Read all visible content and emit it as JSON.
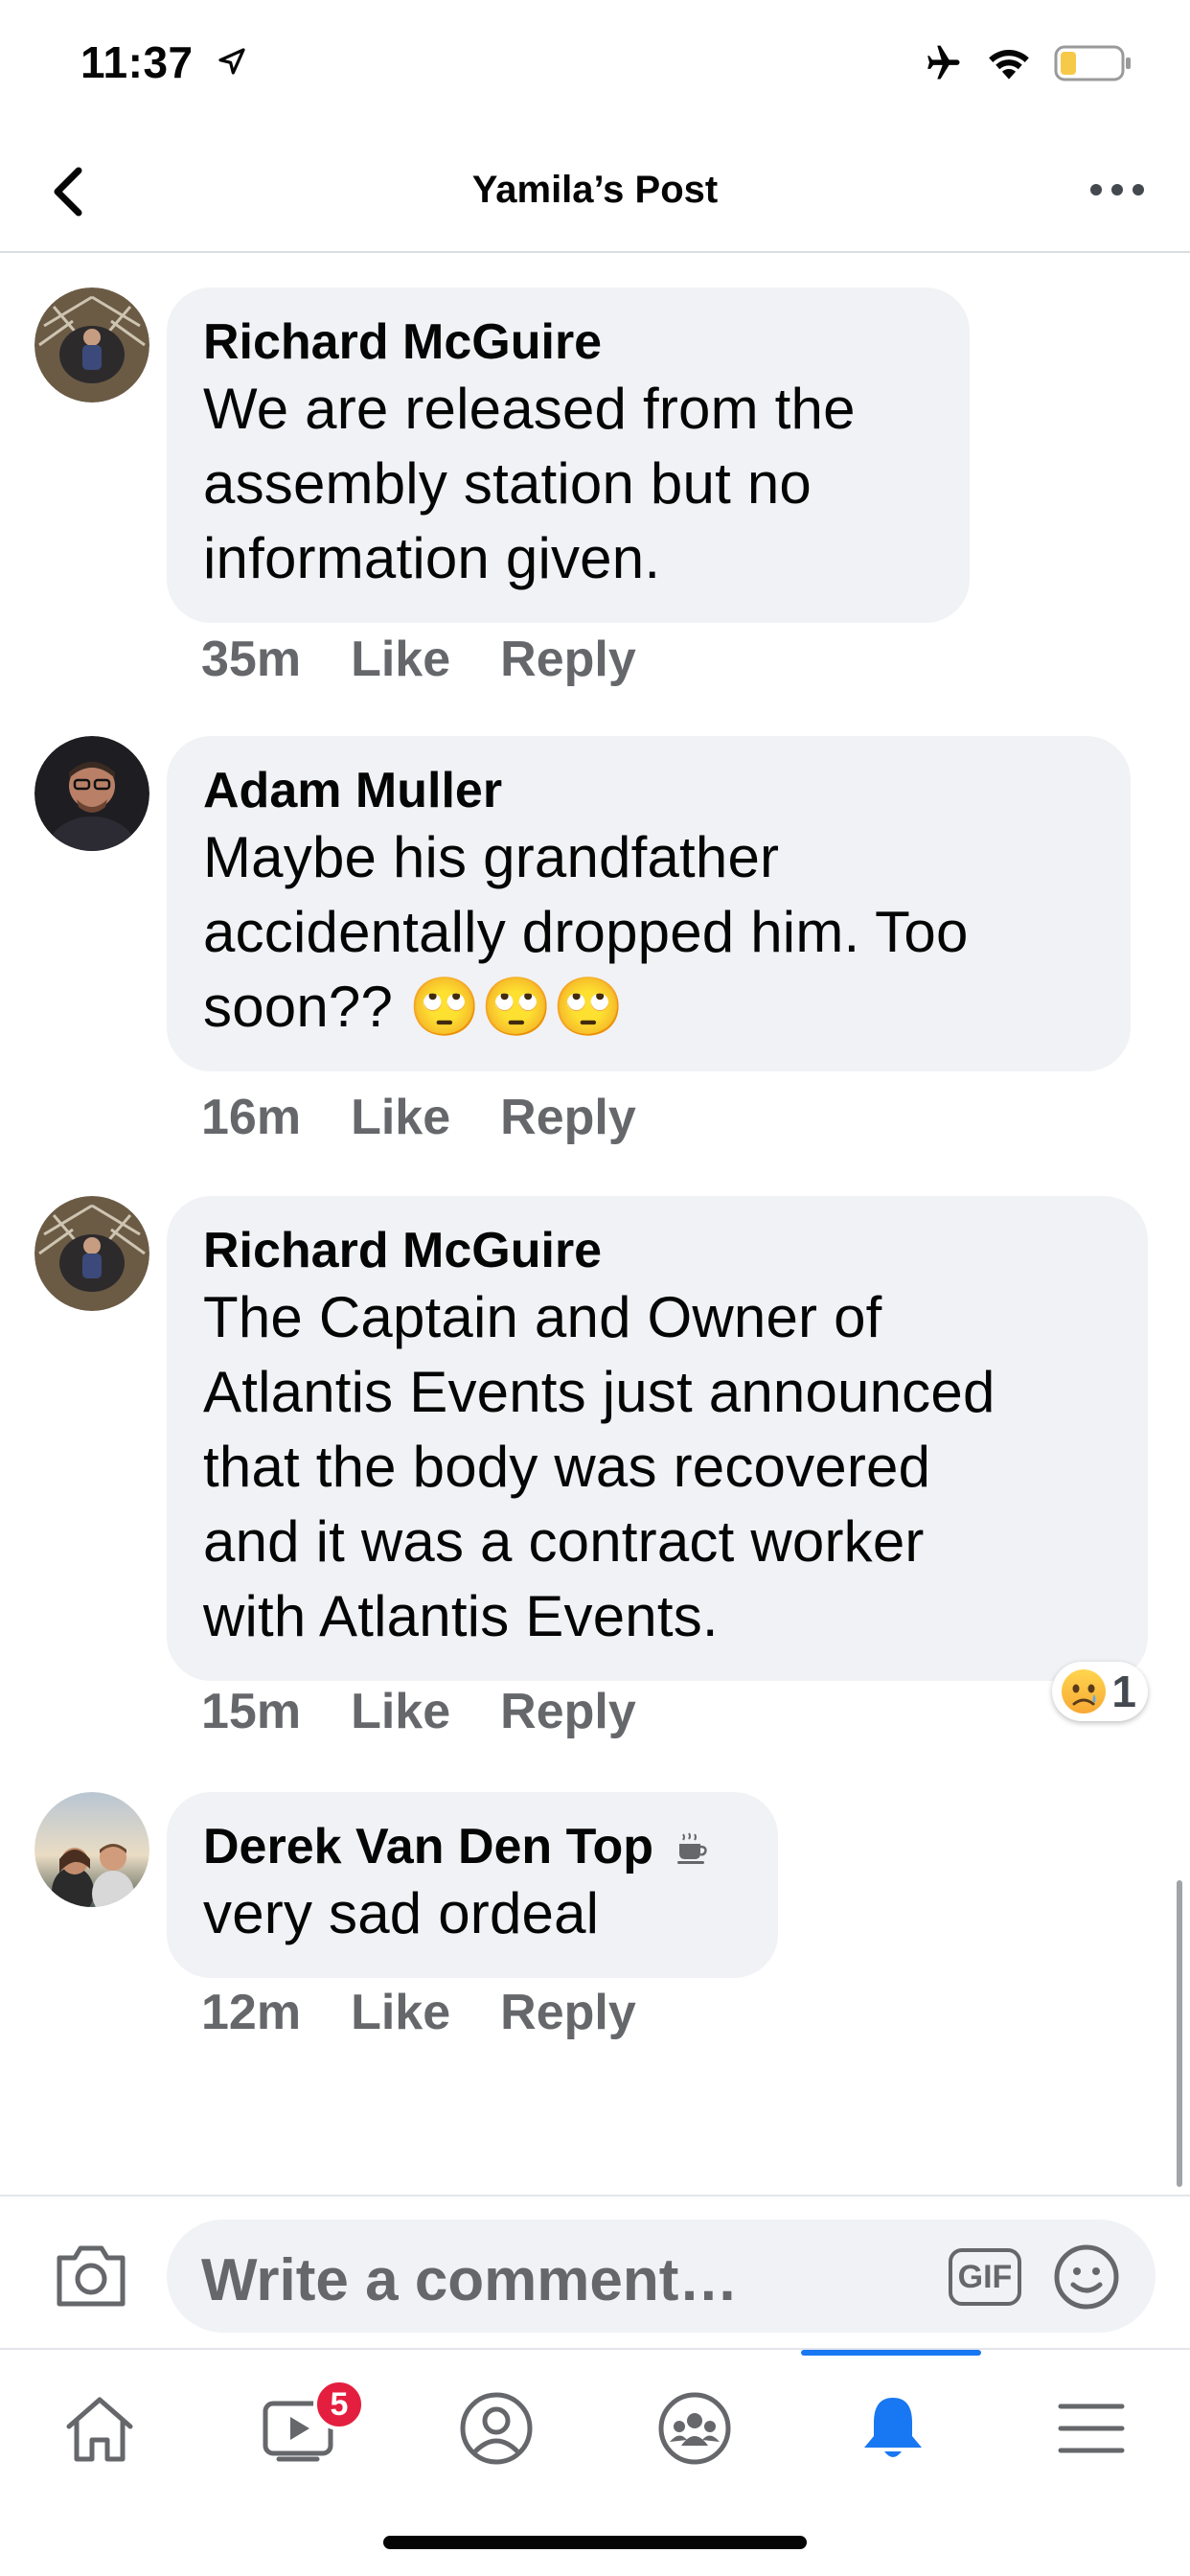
{
  "status": {
    "time": "11:37",
    "icons": [
      "location-arrow-icon",
      "airplane-icon",
      "wifi-icon",
      "battery-low-icon"
    ],
    "battery_color": "#f7c948"
  },
  "header": {
    "title": "Yamila’s Post",
    "back_icon": "chevron-left-icon",
    "more_icon": "more-horizontal-icon"
  },
  "comments": [
    {
      "author": "Richard McGuire",
      "text": "We are released from the\nassembly station but no\ninformation given.",
      "time": "35m",
      "like": "Like",
      "reply": "Reply"
    },
    {
      "author": "Adam Muller",
      "text": "Maybe his grandfather\naccidentally dropped him.  Too\nsoon?? 🙄🙄🙄",
      "time": "16m",
      "like": "Like",
      "reply": "Reply"
    },
    {
      "author": "Richard McGuire",
      "text": "The Captain and Owner of\nAtlantis Events just announced\nthat the body was recovered\nand it was a contract worker\nwith Atlantis Events.",
      "time": "15m",
      "like": "Like",
      "reply": "Reply",
      "reaction": {
        "icon": "sad-face-icon",
        "count": "1"
      }
    },
    {
      "author": "Derek Van Den Top",
      "author_badge_icon": "coffee-cup-icon",
      "text": "very sad ordeal",
      "time": "12m",
      "like": "Like",
      "reply": "Reply"
    }
  ],
  "composer": {
    "placeholder": "Write a comment…",
    "gif_label": "GIF",
    "camera_icon": "camera-icon",
    "emoji_icon": "smiley-icon"
  },
  "tabbar": {
    "tabs": [
      {
        "icon": "home-icon"
      },
      {
        "icon": "watch-video-icon",
        "badge": "5"
      },
      {
        "icon": "profile-icon"
      },
      {
        "icon": "groups-icon"
      },
      {
        "icon": "notifications-bell-icon",
        "active": true
      },
      {
        "icon": "menu-icon"
      }
    ],
    "active_color": "#1877f2"
  }
}
